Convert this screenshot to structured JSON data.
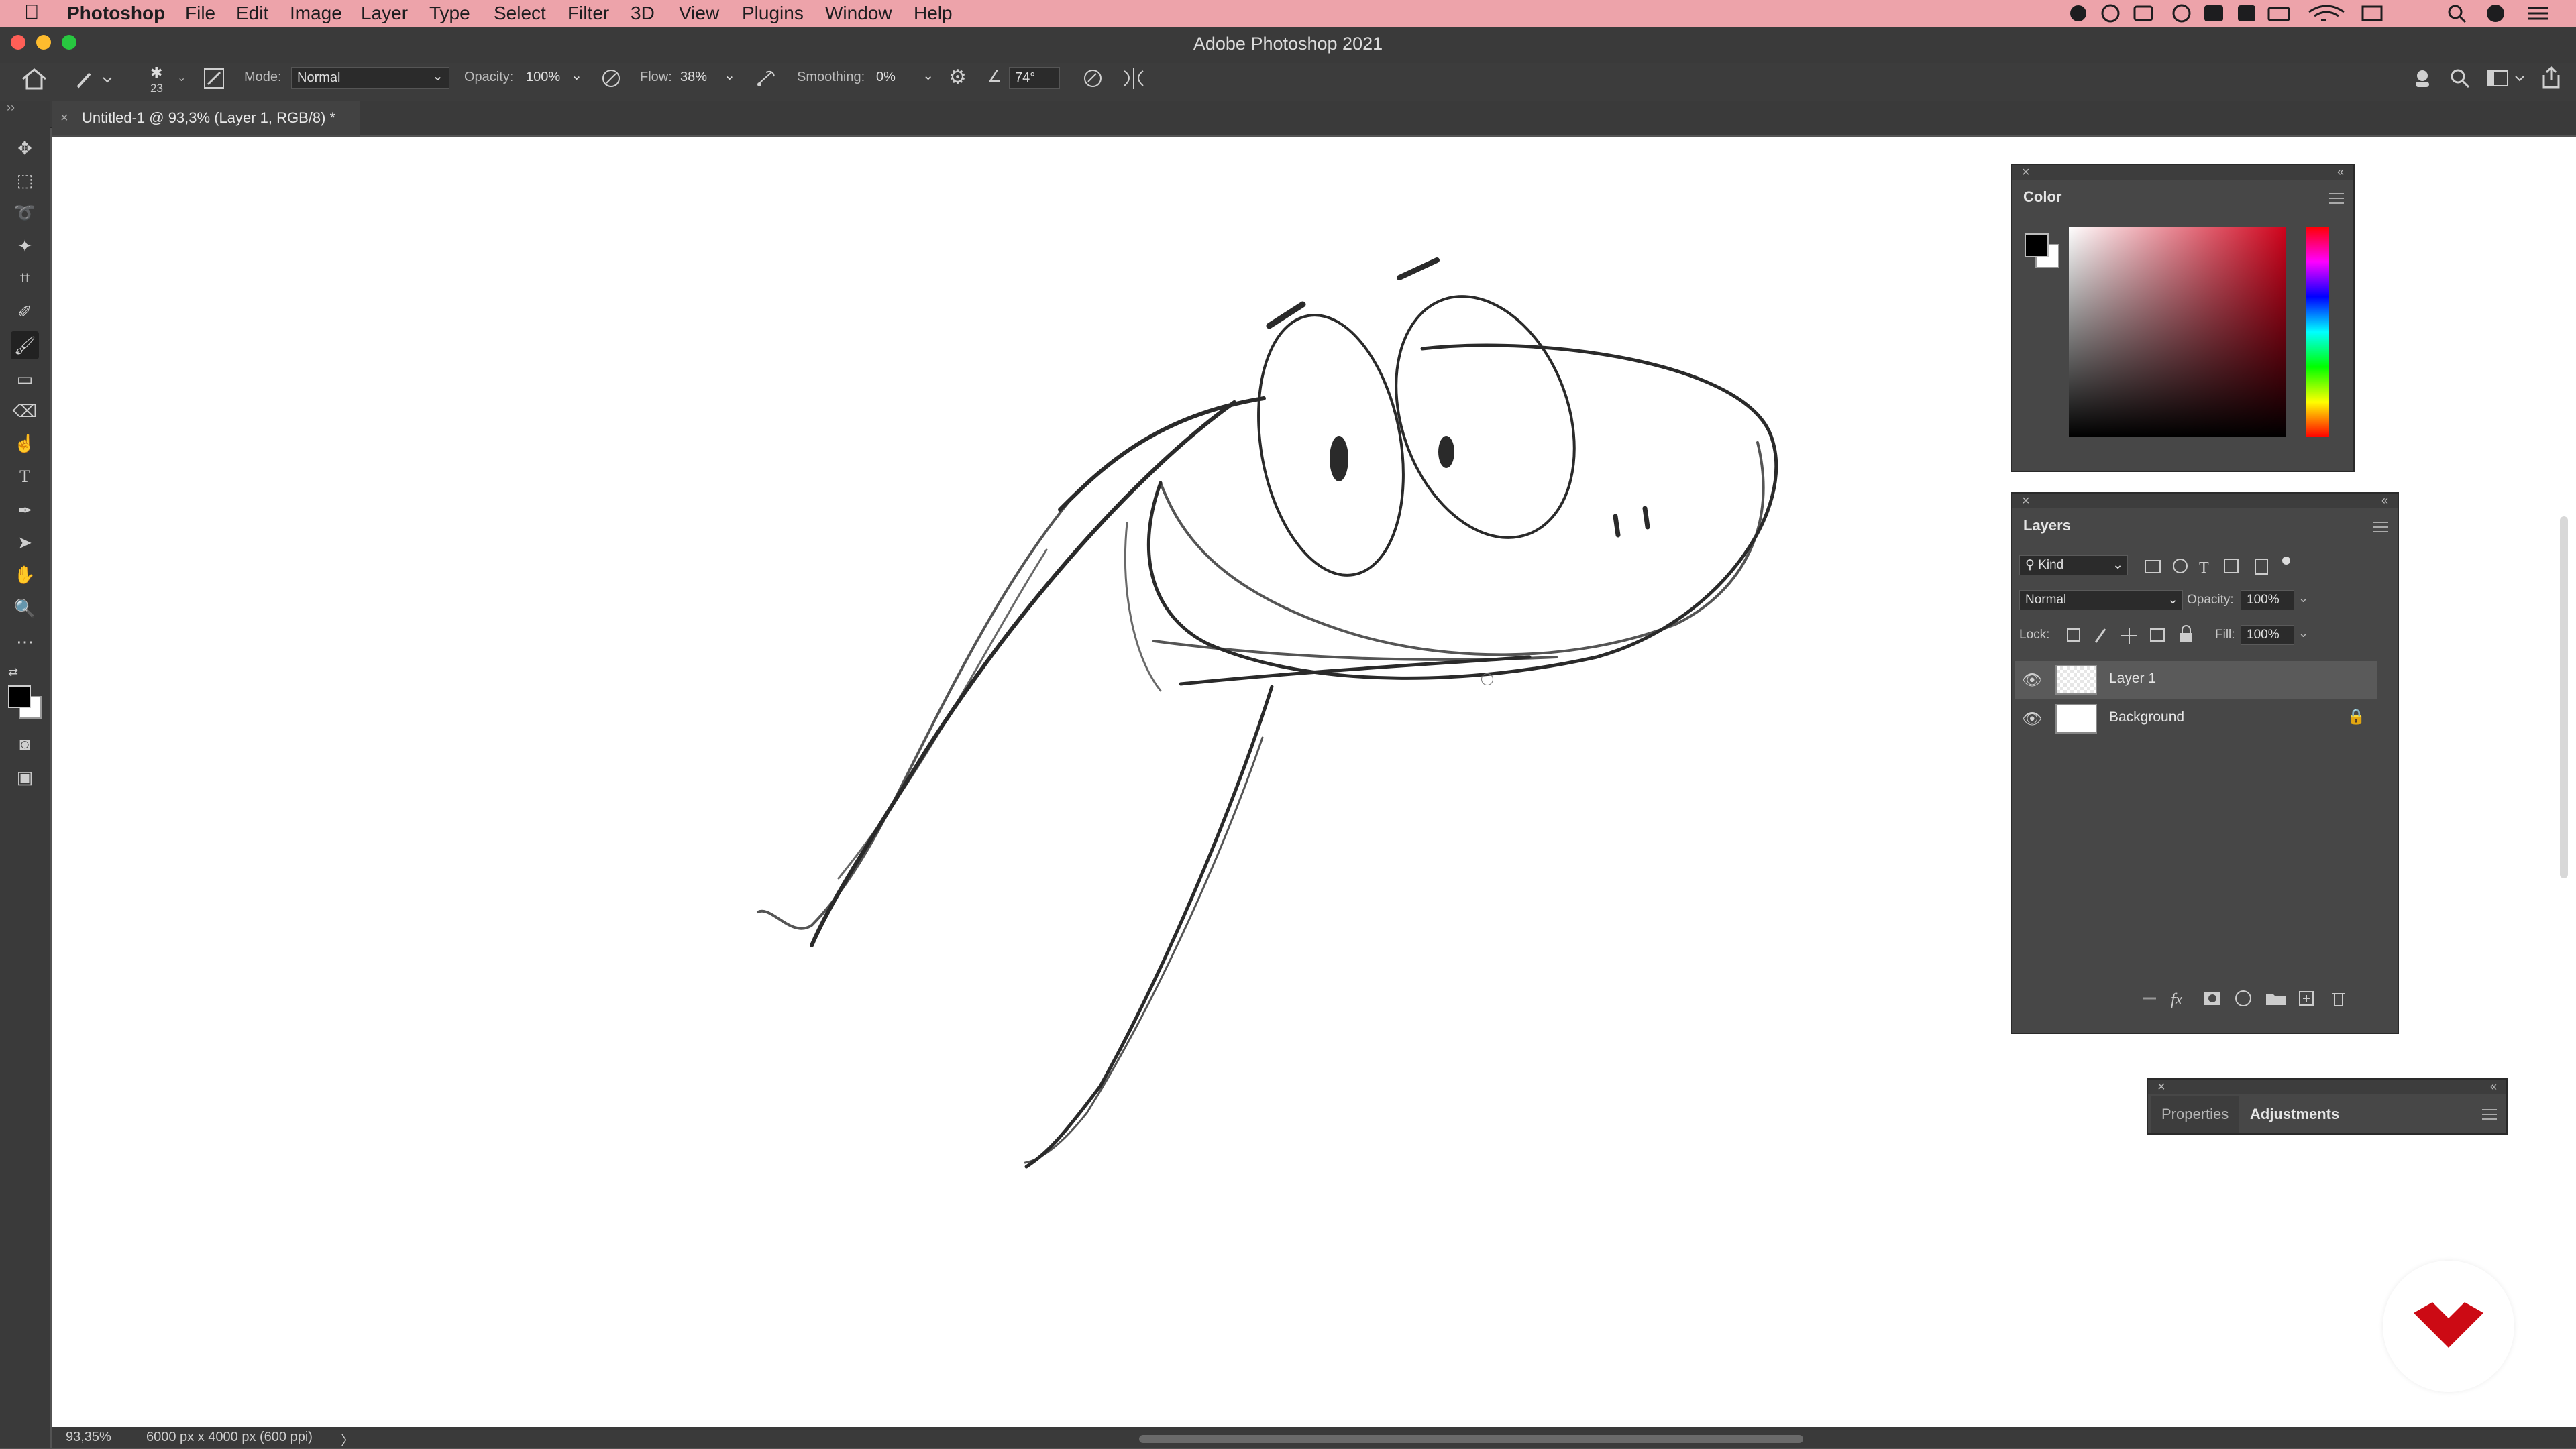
{
  "menubar": {
    "app": "Photoshop",
    "items": [
      "File",
      "Edit",
      "Image",
      "Layer",
      "Type",
      "Select",
      "Filter",
      "3D",
      "View",
      "Plugins",
      "Window",
      "Help"
    ]
  },
  "window": {
    "title": "Adobe Photoshop 2021"
  },
  "options": {
    "brush_size": "23",
    "mode_label": "Mode:",
    "mode_value": "Normal",
    "opacity_label": "Opacity:",
    "opacity_value": "100%",
    "flow_label": "Flow:",
    "flow_value": "38%",
    "smoothing_label": "Smoothing:",
    "smoothing_value": "0%",
    "angle_value": "74°"
  },
  "document": {
    "tab_title": "Untitled-1 @ 93,3% (Layer 1, RGB/8) *"
  },
  "status": {
    "zoom": "93,35%",
    "doc_info": "6000 px x 4000 px (600 ppi)",
    "arrow": "〉"
  },
  "color_panel": {
    "title": "Color"
  },
  "layers_panel": {
    "title": "Layers",
    "kind_label": "Kind",
    "blend_mode": "Normal",
    "opacity_label": "Opacity:",
    "opacity_value": "100%",
    "lock_label": "Lock:",
    "fill_label": "Fill:",
    "fill_value": "100%",
    "layers": [
      {
        "name": "Layer 1",
        "selected": true
      },
      {
        "name": "Background",
        "locked": true
      }
    ]
  },
  "bottom_panel": {
    "tab_properties": "Properties",
    "tab_adjustments": "Adjustments"
  },
  "colors": {
    "menubar_bg": "#eda3aa",
    "panel_bg": "#474747",
    "accent_logo": "#cc0a14"
  }
}
